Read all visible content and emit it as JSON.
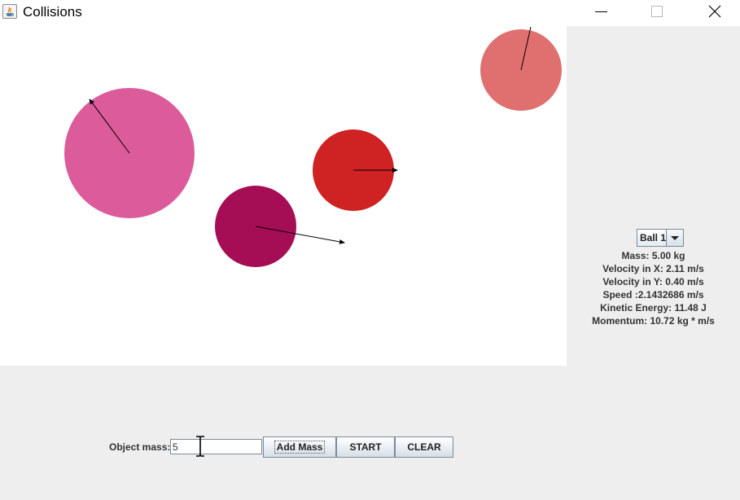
{
  "window": {
    "title": "Collisions",
    "app_icon": "java-icon"
  },
  "window_controls": {
    "minimize_icon": "minimize-icon",
    "maximize_icon": "maximize-icon",
    "close_icon": "close-icon"
  },
  "simulation": {
    "background": "#ffffff",
    "balls": [
      {
        "color": "#dc5b9b"
      },
      {
        "color": "#a50e55"
      },
      {
        "color": "#cf2222"
      },
      {
        "color": "#e07070"
      }
    ]
  },
  "info": {
    "selected_ball": "Ball 1",
    "mass": "Mass: 5.00 kg",
    "vx": "Velocity in X: 2.11 m/s",
    "vy": "Velocity in Y: 0.40 m/s",
    "speed": "Speed :2.1432686 m/s",
    "kinetic_energy": "Kinetic Energy: 11.48 J",
    "momentum": "Momentum: 10.72 kg * m/s"
  },
  "controls": {
    "mass_label": "Object mass:",
    "mass_value": "5",
    "add_mass_label": "Add Mass",
    "start_label": "START",
    "clear_label": "CLEAR"
  }
}
